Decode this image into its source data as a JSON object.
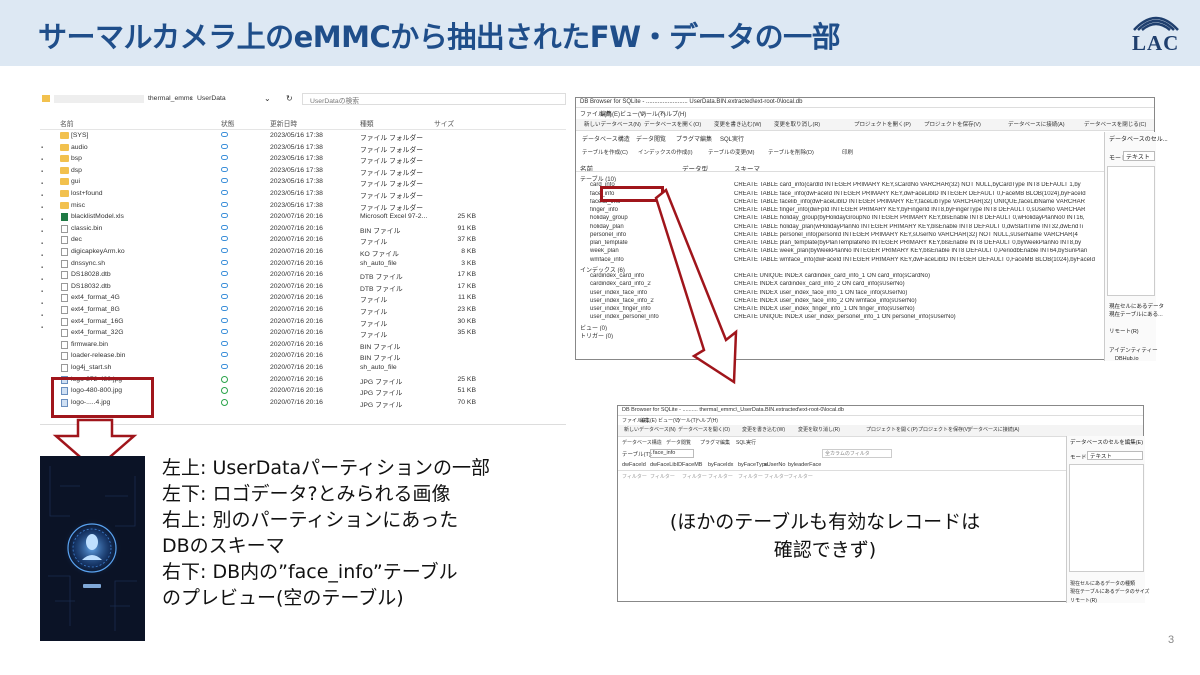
{
  "slide": {
    "title": "サーマルカメラ上のeMMCから抽出されたFW・データの一部",
    "logo": "LAC",
    "page_number": "3",
    "description_lines": [
      "左上: UserDataパーティションの一部",
      "左下: ロゴデータ?とみられる画像",
      "右上: 別のパーティションにあった",
      "DBのスキーマ",
      "右下: DB内の”face_info”テーブル",
      "のプレビュー(空のテーブル)"
    ],
    "note_lines": [
      "(ほかのテーブルも有効なレコードは",
      "確認できず)"
    ]
  },
  "explorer": {
    "breadcrumb": [
      "thermal_emmc",
      "UserData"
    ],
    "search_placeholder": "UserDataの検索",
    "columns": [
      "名前",
      "状態",
      "更新日時",
      "種類",
      "サイズ"
    ],
    "rows": [
      {
        "name": "[SYS]",
        "date": "2023/05/16 17:38",
        "type": "ファイル フォルダー",
        "size": "",
        "kind": "folder"
      },
      {
        "name": "audio",
        "date": "2023/05/16 17:38",
        "type": "ファイル フォルダー",
        "size": "",
        "kind": "folder"
      },
      {
        "name": "bsp",
        "date": "2023/05/16 17:38",
        "type": "ファイル フォルダー",
        "size": "",
        "kind": "folder"
      },
      {
        "name": "dsp",
        "date": "2023/05/16 17:38",
        "type": "ファイル フォルダー",
        "size": "",
        "kind": "folder"
      },
      {
        "name": "gui",
        "date": "2023/05/16 17:38",
        "type": "ファイル フォルダー",
        "size": "",
        "kind": "folder"
      },
      {
        "name": "lost+found",
        "date": "2023/05/16 17:38",
        "type": "ファイル フォルダー",
        "size": "",
        "kind": "folder"
      },
      {
        "name": "misc",
        "date": "2023/05/16 17:38",
        "type": "ファイル フォルダー",
        "size": "",
        "kind": "folder"
      },
      {
        "name": "blacklistModel.xls",
        "date": "2020/07/16 20:16",
        "type": "Microsoft Excel 97-2...",
        "size": "25 KB",
        "kind": "xls"
      },
      {
        "name": "classic.bin",
        "date": "2020/07/16 20:16",
        "type": "BIN ファイル",
        "size": "91 KB",
        "kind": "file"
      },
      {
        "name": "dec",
        "date": "2020/07/16 20:16",
        "type": "ファイル",
        "size": "37 KB",
        "kind": "file"
      },
      {
        "name": "digicapkeyArm.ko",
        "date": "2020/07/16 20:16",
        "type": "KO ファイル",
        "size": "8 KB",
        "kind": "file"
      },
      {
        "name": "dnssync.sh",
        "date": "2020/07/16 20:16",
        "type": "sh_auto_file",
        "size": "3 KB",
        "kind": "file"
      },
      {
        "name": "DS18028.dtb",
        "date": "2020/07/16 20:16",
        "type": "DTB ファイル",
        "size": "17 KB",
        "kind": "file"
      },
      {
        "name": "DS18032.dtb",
        "date": "2020/07/16 20:16",
        "type": "DTB ファイル",
        "size": "17 KB",
        "kind": "file"
      },
      {
        "name": "ext4_format_4G",
        "date": "2020/07/16 20:16",
        "type": "ファイル",
        "size": "11 KB",
        "kind": "file"
      },
      {
        "name": "ext4_format_8G",
        "date": "2020/07/16 20:16",
        "type": "ファイル",
        "size": "23 KB",
        "kind": "file"
      },
      {
        "name": "ext4_format_16G",
        "date": "2020/07/16 20:16",
        "type": "ファイル",
        "size": "30 KB",
        "kind": "file"
      },
      {
        "name": "ext4_format_32G",
        "date": "2020/07/16 20:16",
        "type": "ファイル",
        "size": "35 KB",
        "kind": "file"
      },
      {
        "name": "firmware.bin",
        "date": "2020/07/16 20:16",
        "type": "BIN ファイル",
        "size": "",
        "kind": "file"
      },
      {
        "name": "loader-release.bin",
        "date": "2020/07/16 20:16",
        "type": "BIN ファイル",
        "size": "",
        "kind": "file"
      },
      {
        "name": "log4j_start.sh",
        "date": "2020/07/16 20:16",
        "type": "sh_auto_file",
        "size": "",
        "kind": "file"
      },
      {
        "name": "logo-272-480.jpg",
        "date": "2020/07/16 20:16",
        "type": "JPG ファイル",
        "size": "25 KB",
        "kind": "img"
      },
      {
        "name": "logo-480-800.jpg",
        "date": "2020/07/16 20:16",
        "type": "JPG ファイル",
        "size": "51 KB",
        "kind": "img"
      },
      {
        "name": "logo-.....4.jpg",
        "date": "2020/07/16 20:16",
        "type": "JPG ファイル",
        "size": "70 KB",
        "kind": "img"
      }
    ]
  },
  "db_schema": {
    "window_title": "DB Browser for SQLite - ......................... UserData.BIN.extracted\\ext-root-0\\local.db",
    "menu": [
      "ファイル(F)",
      "編集(E)",
      "ビュー(V)",
      "ツール(T)",
      "ヘルプ(H)"
    ],
    "toolbar": [
      "新しいデータベース(N)",
      "データベースを開く(O)",
      "変更を書き込む(W)",
      "変更を取り消し(R)",
      "プロジェクトを開く(P)",
      "プロジェクトを保存(V)",
      "データベースに接続(A)",
      "データベースを閉じる(C)"
    ],
    "tabs": [
      "データベース構造",
      "データ閲覧",
      "プラグマ編集",
      "SQL実行"
    ],
    "subtoolbar": [
      "テーブルを作成(C)",
      "インデックスの作成(I)",
      "テーブルの変更(M)",
      "テーブルを削除(D)",
      "印刷"
    ],
    "columns": [
      "名前",
      "データ型",
      "スキーマ"
    ],
    "right_panel_title": "データベースのセル...",
    "mode_label": "モード",
    "mode_value": "テキスト",
    "tree": [
      {
        "name": "テーブル (10)",
        "schema": "",
        "level": 0
      },
      {
        "name": "card_info",
        "schema": "CREATE TABLE card_info(cardId INTEGER PRIMARY KEY,sCardNo VARCHAR(32) NOT NULL,byCardType INT8 DEFAULT 1,by",
        "level": 1
      },
      {
        "name": "face_info",
        "schema": "CREATE TABLE face_info(dwFaceId INTEGER PRIMARY KEY,dwFaceLibID INTEGER DEFAULT 0,FaceMB BLOB(1024),byFaceId",
        "level": 1
      },
      {
        "name": "facelib_info",
        "schema": "CREATE TABLE facelib_info(dwFaceLibID INTEGER PRIMARY KEY,faceLibType VARCHAR(32) UNIQUE,faceLibName VARCHAR",
        "level": 1
      },
      {
        "name": "finger_info",
        "schema": "CREATE TABLE finger_info(dwFpId INTEGER PRIMARY KEY,byFingerId INT8,byFingerType INT8 DEFAULT 0,sUserNo VARCHAR",
        "level": 1
      },
      {
        "name": "holiday_group",
        "schema": "CREATE TABLE holiday_group(byHolidayGroupNo INTEGER PRIMARY KEY,blsEnable INT8 DEFAULT 0,wHolidayPlanNo0 INT16,",
        "level": 1
      },
      {
        "name": "holiday_plan",
        "schema": "CREATE TABLE holiday_plan(wHolidayPlanNo INTEGER PRIMARY KEY,blsEnable INT8 DEFAULT 0,dwStartTime INT32,dwEndTi",
        "level": 1
      },
      {
        "name": "personel_info",
        "schema": "CREATE TABLE personel_info(personId INTEGER PRIMARY KEY,sUserNo VARCHAR(32) NOT NULL,sUserName VARCHAR(4",
        "level": 1
      },
      {
        "name": "plan_template",
        "schema": "CREATE TABLE plan_template(byPlanTemplateNo INTEGER PRIMARY KEY,blsEnable INT8 DEFAULT 0,byWeekPlanNo INT8,by",
        "level": 1
      },
      {
        "name": "week_plan",
        "schema": "CREATE TABLE week_plan(byWeekPlanNo INTEGER PRIMARY KEY,blsEnable INT8 DEFAULT 0,PeriodbEnable INT64,bySunPlan",
        "level": 1
      },
      {
        "name": "wmface_info",
        "schema": "CREATE TABLE wmface_info(dwFaceId INTEGER PRIMARY KEY,dwFaceLibID INTEGER DEFAULT 0,FaceMB BLOB(1024),byFaceId",
        "level": 1
      },
      {
        "name": "インデックス (6)",
        "schema": "",
        "level": 0
      },
      {
        "name": "cardindex_card_info",
        "schema": "CREATE UNIQUE INDEX cardindex_card_info_1 ON card_info(sCardNo)",
        "level": 1
      },
      {
        "name": "cardindex_card_info_2",
        "schema": "CREATE INDEX cardindex_card_info_2 ON card_info(sUserNo)",
        "level": 1
      },
      {
        "name": "user_index_face_info",
        "schema": "CREATE INDEX user_index_face_info_1 ON face_info(sUserNo)",
        "level": 1
      },
      {
        "name": "user_index_face_info_2",
        "schema": "CREATE INDEX user_index_face_info_2 ON wmface_info(sUserNo)",
        "level": 1
      },
      {
        "name": "user_index_finger_info",
        "schema": "CREATE INDEX user_index_finger_info_1 ON finger_info(sUserNo)",
        "level": 1
      },
      {
        "name": "user_index_personel_info",
        "schema": "CREATE UNIQUE INDEX user_index_personel_info_1 ON personel_info(sUserNo)",
        "level": 1
      },
      {
        "name": "ビュー (0)",
        "schema": "",
        "level": 0
      },
      {
        "name": "トリガー (0)",
        "schema": "",
        "level": 0
      }
    ],
    "right_bottom_labels": [
      "現在セルにあるデータ",
      "現在テーブルにある...",
      "リモート(R)",
      "アイデンティティー",
      "DBHub.io"
    ]
  },
  "db_preview": {
    "window_title": "DB Browser for SQLite - .......... thermal_emmc\\_UserData.BIN.extracted\\ext-root-0\\local.db",
    "menu": [
      "ファイル(F)",
      "編集(E)",
      "ビュー(V)",
      "ツール(T)",
      "ヘルプ(H)"
    ],
    "toolbar": [
      "新しいデータベース(N)",
      "データベースを開く(O)",
      "変更を書き込む(W)",
      "変更を取り消し(R)",
      "プロジェクトを開く(P)",
      "プロジェクトを保存(V)",
      "データベースに接続(A)"
    ],
    "tabs": [
      "データベース構造",
      "データ閲覧",
      "プラグマ編集",
      "SQL実行"
    ],
    "table_label": "テーブル(T):",
    "table_value": "face_info",
    "filter_placeholder": "全カラムのフィルタ",
    "columns": [
      "dwFaceId",
      "dwFaceLibID",
      "FaceMB",
      "byFaceIdx",
      "byFaceType",
      "sUserNo",
      "byleaderFace"
    ],
    "filter_text": "フィルター",
    "right_panel_title": "データベースのセルを編集(E)",
    "mode_label": "モード",
    "mode_value": "テキスト",
    "right_bottom_labels": [
      "現在セルにあるデータの種類",
      "現在テーブルにあるデータのサイズ",
      "リモート(R)"
    ]
  },
  "colors": {
    "accent": "#1f4e8a",
    "highlight": "#a0151b",
    "header_bg": "#dde8f3"
  }
}
